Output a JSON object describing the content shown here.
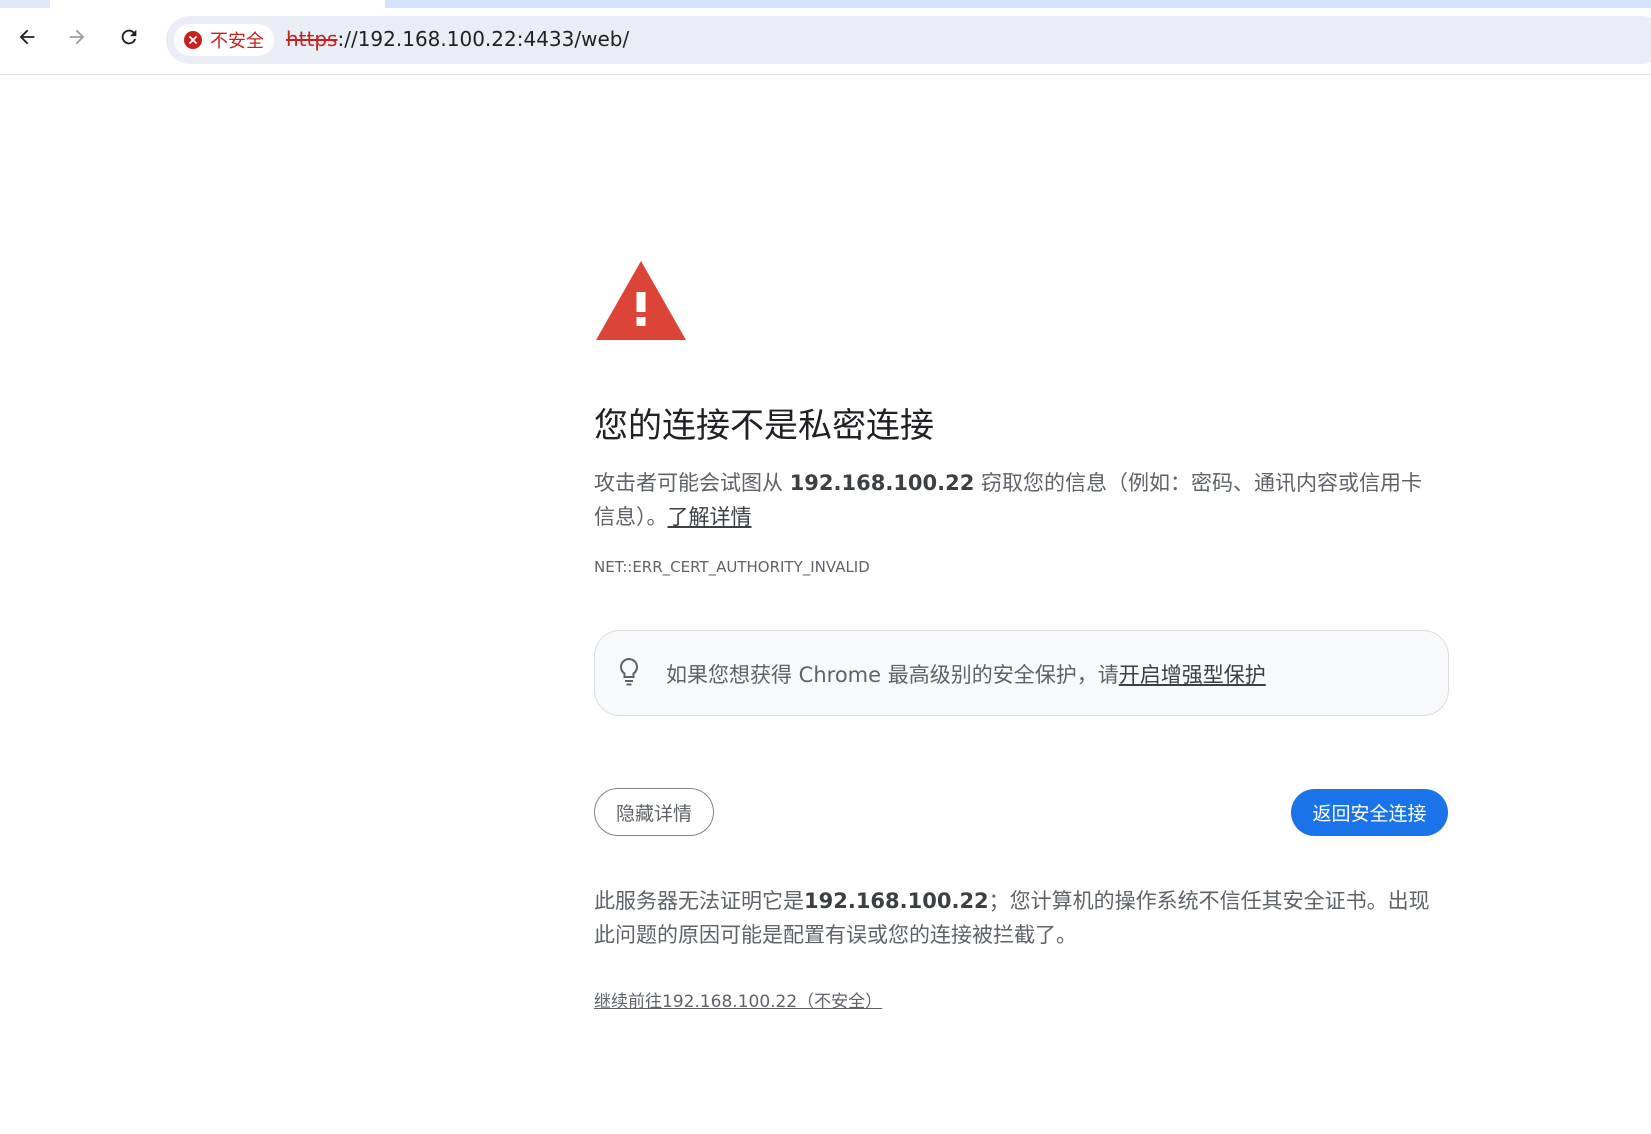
{
  "browser": {
    "security_chip_label": "不安全",
    "url_scheme": "https",
    "url_rest": "://192.168.100.22:4433/web/",
    "icons": [
      "back-arrow-icon",
      "forward-arrow-icon",
      "reload-icon",
      "not-secure-icon"
    ]
  },
  "interstitial": {
    "heading": "您的连接不是私密连接",
    "para1_prefix": "攻击者可能会试图从 ",
    "para1_host": "192.168.100.22",
    "para1_suffix": " 窃取您的信息（例如：密码、通讯内容或信用卡信息）。",
    "learn_more": "了解详情",
    "error_code": "NET::ERR_CERT_AUTHORITY_INVALID",
    "tip_text": "如果您想获得 Chrome 最高级别的安全保护，请",
    "tip_link": "开启增强型保护",
    "hide_details_button": "隐藏详情",
    "back_to_safety_button": "返回安全连接",
    "details_prefix": "此服务器无法证明它是",
    "details_host": "192.168.100.22",
    "details_suffix": "；您计算机的操作系统不信任其安全证书。出现此问题的原因可能是配置有误或您的连接被拦截了。",
    "proceed_link": "继续前往192.168.100.22（不安全）"
  },
  "colors": {
    "warning_red": "#db4437",
    "not_secure_red": "#c5221f",
    "primary_blue": "#1a73e8",
    "text_gray": "#5f6368"
  }
}
